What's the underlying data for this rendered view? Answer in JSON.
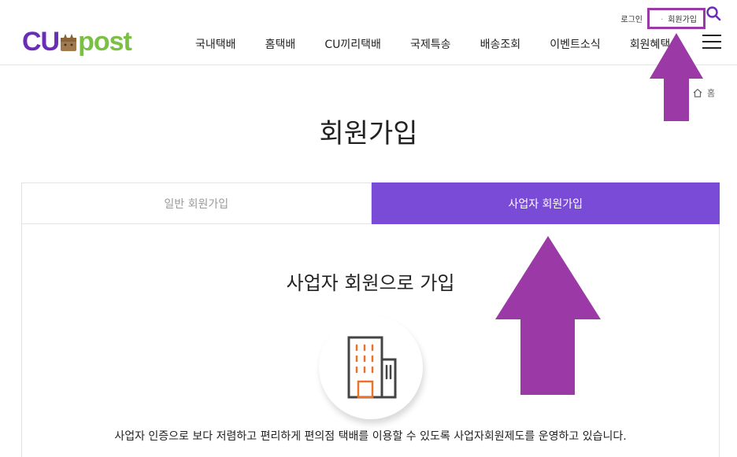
{
  "logo": {
    "left": "CU",
    "right": "post"
  },
  "utility": {
    "login": "로그인",
    "join": "회원가입"
  },
  "nav": {
    "items": [
      "국내택배",
      "홈택배",
      "CU끼리택배",
      "국제특송",
      "배송조회",
      "이벤트소식",
      "회원혜택"
    ]
  },
  "breadcrumb": {
    "home": "홈"
  },
  "page": {
    "title": "회원가입"
  },
  "tabs": [
    {
      "label": "일반 회원가입",
      "active": false
    },
    {
      "label": "사업자 회원가입",
      "active": true
    }
  ],
  "section": {
    "title": "사업자 회원으로 가입",
    "description": "사업자 인증으로 보다 저렴하고 편리하게 편의점 택배를 이용할 수 있도록 사업자회원제도를 운영하고 있습니다."
  },
  "icons": {
    "search": "search-icon",
    "menu": "hamburger-menu-icon",
    "home": "home-icon",
    "building": "building-icon",
    "annotation": "arrow-up-icon"
  },
  "colors": {
    "brand_purple": "#6a2db5",
    "brand_green": "#7ac143",
    "tab_active": "#7a4bd6",
    "annotation": "#9b3aa6"
  }
}
